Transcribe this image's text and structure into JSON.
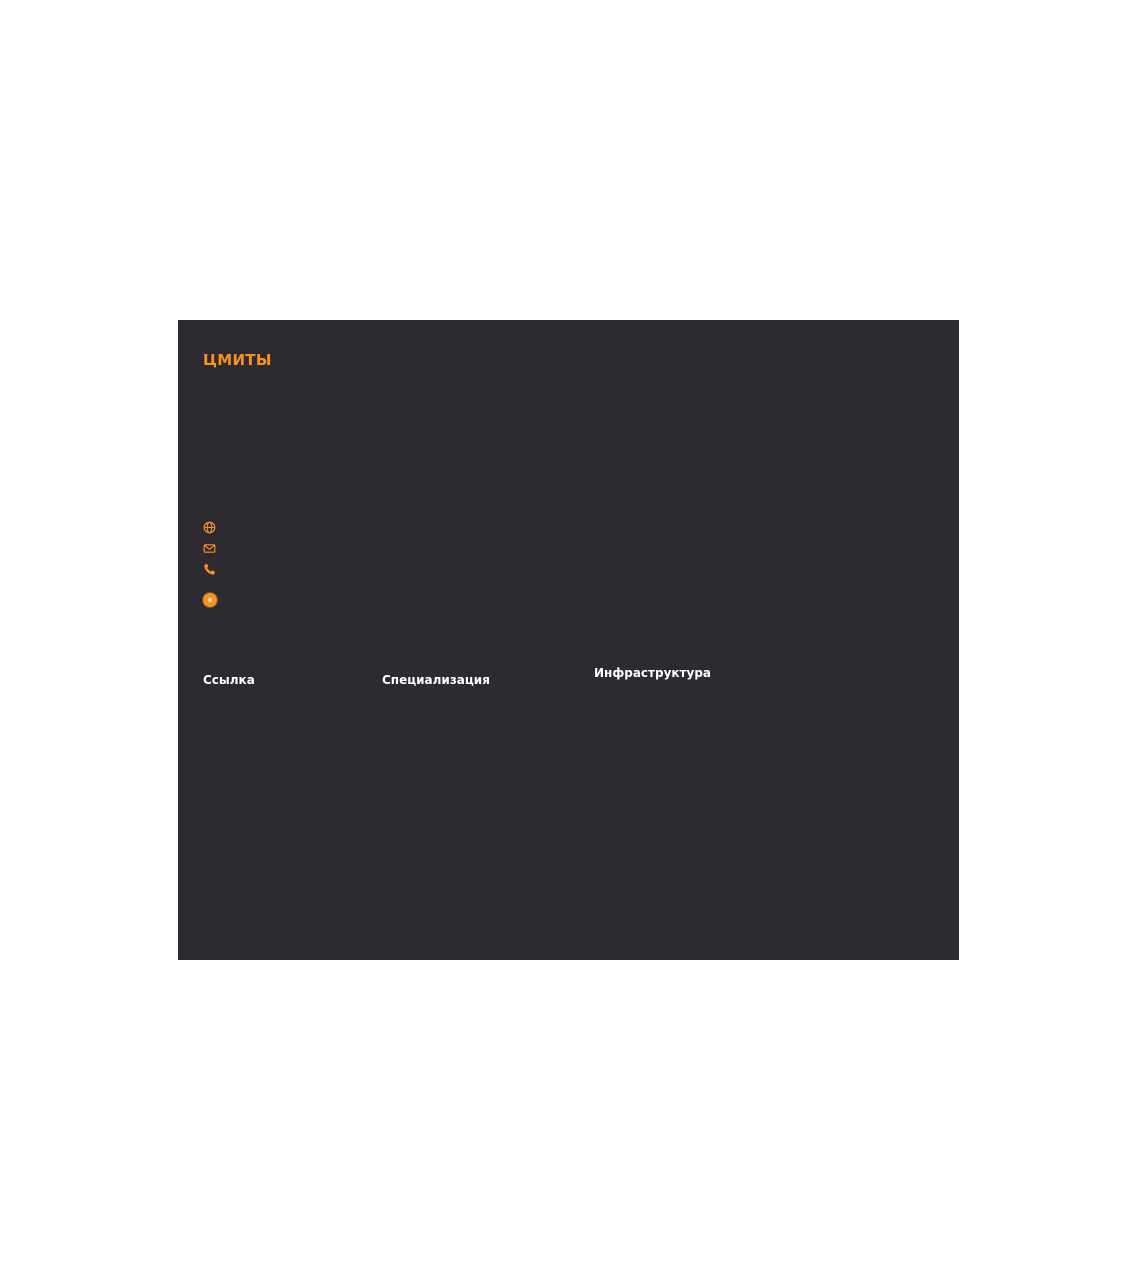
{
  "card": {
    "brand": "ЦМИТЫ",
    "contacts": {
      "website_icon": "globe-icon",
      "email_icon": "mail-icon",
      "phone_icon": "phone-icon"
    },
    "status_icon": "radio-dot-icon",
    "sections": {
      "link_label": "Ссылка",
      "specialization_label": "Специализация",
      "infrastructure_label": "Инфраструктура"
    }
  },
  "colors": {
    "background": "#2d2b31",
    "accent": "#f7931e",
    "text": "#ffffff",
    "page": "#ffffff"
  }
}
